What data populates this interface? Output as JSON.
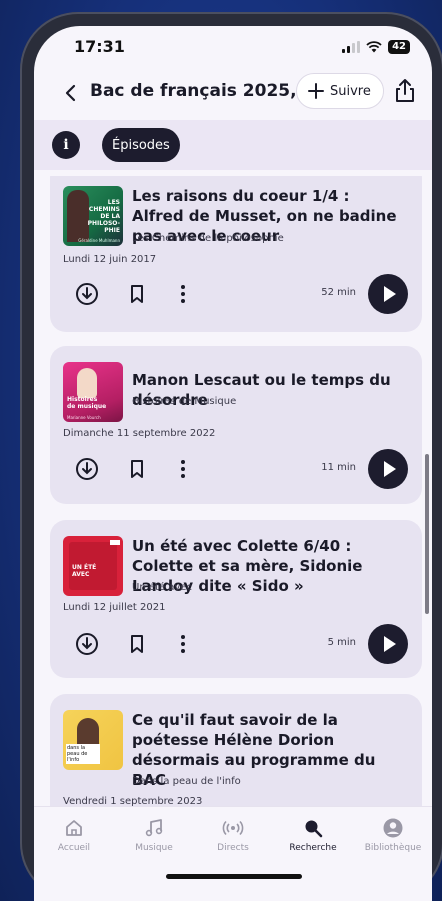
{
  "status_bar": {
    "time": "17:31",
    "battery": "42"
  },
  "header": {
    "title": "Bac de français 2025, le...",
    "follow_label": "Suivre"
  },
  "tabs": {
    "info_label": "i",
    "episodes_label": "Épisodes"
  },
  "episodes": [
    {
      "title": "Les raisons du coeur 1/4 : Alfred de Musset, on ne badine pas avec le coeur",
      "show": "Les Chemins de la philosophie",
      "date": "Lundi 12 juin 2017",
      "duration": "52 min",
      "thumb_text": "LES CHEMINS DE LA PHILOSO-PHIE",
      "thumb_caption": "Géraldine Muhlmann",
      "thumb_color": "#1f8a56"
    },
    {
      "title": "Manon Lescaut ou le temps du désordre",
      "show": "Histoires de Musique",
      "date": "Dimanche 11 septembre 2022",
      "duration": "11 min",
      "thumb_text": "Histoires de musique",
      "thumb_caption": "Marianne Vourch",
      "thumb_color": "#c0266d"
    },
    {
      "title": "Un été avec Colette 6/40 : Colette et sa mère, Sidonie Landoy dite « Sido »",
      "show": "Un été avec",
      "date": "Lundi 12 juillet 2021",
      "duration": "5 min",
      "thumb_text": "UN ÉTÉ AVEC",
      "thumb_caption": "",
      "thumb_color": "#d8213a"
    },
    {
      "title": "Ce qu'il faut savoir de la poétesse Hélène Dorion désormais au programme du BAC",
      "show": "Dans la peau de l'info",
      "date": "Vendredi 1 septembre 2023",
      "duration": "",
      "thumb_text": "dans la peau de l'info",
      "thumb_caption": "",
      "thumb_color": "#f2c84a"
    }
  ],
  "tab_bar": [
    {
      "label": "Accueil",
      "icon": "home-icon",
      "active": false
    },
    {
      "label": "Musique",
      "icon": "music-icon",
      "active": false
    },
    {
      "label": "Directs",
      "icon": "live-icon",
      "active": false
    },
    {
      "label": "Recherche",
      "icon": "search-icon",
      "active": true
    },
    {
      "label": "Bibliothèque",
      "icon": "library-icon",
      "active": false
    }
  ],
  "colors": {
    "accent": "#1d1c2e",
    "card_bg": "#e7e3f1",
    "background": "#f7f5fb"
  }
}
